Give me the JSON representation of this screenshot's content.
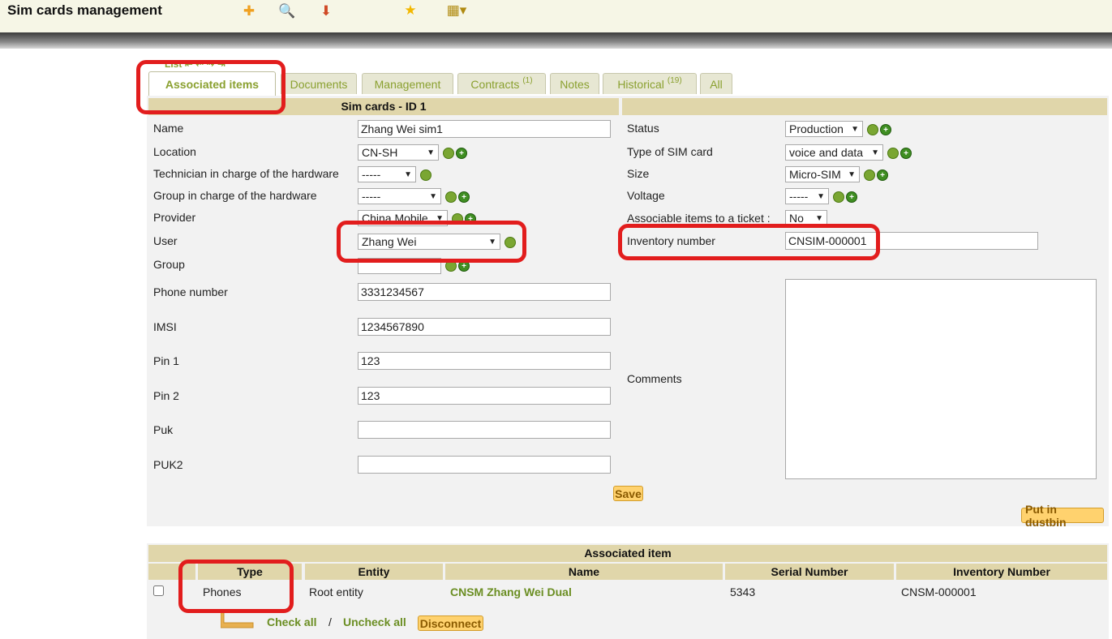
{
  "header": {
    "title": "Sim cards management",
    "tools": [
      {
        "name": "add-icon",
        "glyph": "✚"
      },
      {
        "name": "search-icon",
        "glyph": "🔍"
      },
      {
        "name": "template-icon",
        "glyph": "⬇"
      },
      {
        "name": "star-icon",
        "glyph": "★"
      },
      {
        "name": "columns-icon",
        "glyph": "▦▾"
      }
    ]
  },
  "nav_peek": "List",
  "tabs": [
    {
      "label": "Associated items",
      "badge": ""
    },
    {
      "label": "Documents",
      "badge": ""
    },
    {
      "label": "Management",
      "badge": ""
    },
    {
      "label": "Contracts",
      "badge": "(1)"
    },
    {
      "label": "Notes",
      "badge": ""
    },
    {
      "label": "Historical",
      "badge": "(19)"
    },
    {
      "label": "All",
      "badge": ""
    }
  ],
  "form": {
    "section_title": "Sim cards - ID 1",
    "left": {
      "name_label": "Name",
      "name_value": "Zhang Wei sim1",
      "location_label": "Location",
      "location_value": "CN-SH",
      "tech_label": "Technician in charge of the hardware",
      "tech_value": "-----",
      "group_hw_label": "Group in charge of the hardware",
      "group_hw_value": "-----",
      "provider_label": "Provider",
      "provider_value": "China Mobile",
      "user_label": "User",
      "user_value": "Zhang Wei",
      "group_label": "Group",
      "phone_label": "Phone number",
      "phone_value": "3331234567",
      "imsi_label": "IMSI",
      "imsi_value": "1234567890",
      "pin1_label": "Pin 1",
      "pin1_value": "123",
      "pin2_label": "Pin 2",
      "pin2_value": "123",
      "puk_label": "Puk",
      "puk_value": "",
      "puk2_label": "PUK2",
      "puk2_value": ""
    },
    "right": {
      "status_label": "Status",
      "status_value": "Production",
      "type_label": "Type of SIM card",
      "type_value": "voice and data",
      "size_label": "Size",
      "size_value": "Micro-SIM",
      "voltage_label": "Voltage",
      "voltage_value": "-----",
      "assoc_label": "Associable items to a ticket :",
      "assoc_value": "No",
      "inventory_label": "Inventory number",
      "inventory_value": "CNSIM-000001",
      "comments_label": "Comments",
      "comments_value": ""
    },
    "save_label": "Save",
    "dustbin_label": "Put in dustbin"
  },
  "associated": {
    "title": "Associated item",
    "columns": [
      "Type",
      "Entity",
      "Name",
      "Serial Number",
      "Inventory Number"
    ],
    "rows": [
      {
        "type": "Phones",
        "entity": "Root entity",
        "name": "CNSM Zhang Wei Dual",
        "serial": "5343",
        "inventory": "CNSM-000001"
      }
    ],
    "check_all": "Check all",
    "separator": "/",
    "uncheck_all": "Uncheck all",
    "disconnect": "Disconnect"
  },
  "colors": {
    "accent_green": "#8aa02f",
    "highlight_red": "#e21d1d",
    "section_tan": "#e0d6aa",
    "button_orange": "#ffd26e"
  }
}
